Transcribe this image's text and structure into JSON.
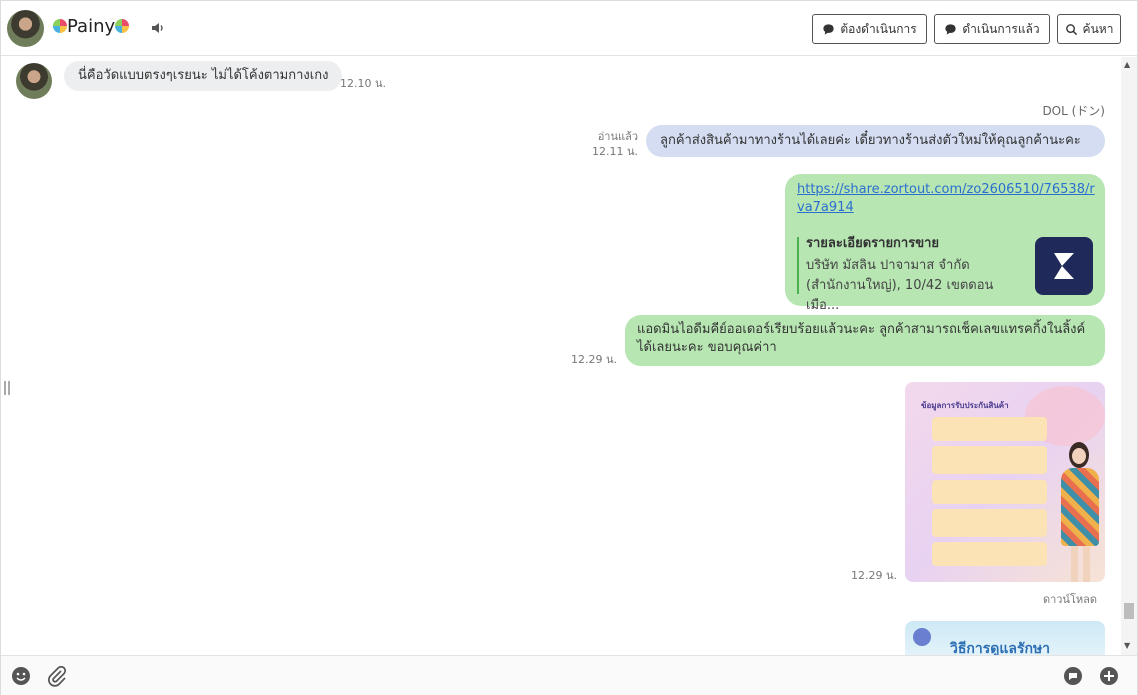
{
  "header": {
    "contact_name": "Painy",
    "buttons": {
      "todo": "ต้องดำเนินการ",
      "done": "ดำเนินการแล้ว",
      "search": "ค้นหา"
    }
  },
  "messages": {
    "m1": {
      "text": "นี่คือวัดแบบตรงๆเรยนะ ไม่ได้โค้งตามกางเกง",
      "time": "12.10 น."
    },
    "agent_name": "DOL (ドン)",
    "m2": {
      "read": "อ่านแล้ว",
      "time": "12.11 น.",
      "text": "ลูกค้าส่งสินค้ามาทางร้านได้เลยค่ะ เดี๋ยวทางร้านส่งตัวใหม่ให้คุณลูกค้านะคะ"
    },
    "m3": {
      "link_line1": "https://share.zortout.com/zo2606510/76538/r",
      "link_line2": "va7a914",
      "preview_title": "รายละเอียดรายการขาย",
      "preview_desc1": "บริษัท มัสลิน ปาจามาส จำกัด",
      "preview_desc2": "(สำนักงานใหญ่), 10/42 เขตดอนเมือ..."
    },
    "m4": {
      "time": "12.29 น.",
      "line1": "แอดมินไอดีมคีย์ออเดอร์เรียบร้อยแล้วนะคะ ลูกค้าสามารถเช็คเลขแทรคกิ้งในลิ้งค์",
      "line2": "ได้เลยนะคะ ขอบคุณค่าา"
    },
    "m5": {
      "time": "12.29 น.",
      "image_title": "ข้อมูลการรับประกันสินค้า",
      "download": "ดาวน์โหลด"
    },
    "m6": {
      "image_title": "วิธีการดูแลรักษา"
    }
  },
  "colors": {
    "incoming": "#eceef0",
    "outgoing_blue": "#d4ddf2",
    "outgoing_green": "#b7e6b3",
    "link": "#2b6fcf"
  },
  "icons": [
    "speaker-icon",
    "chat-bubble-icon",
    "search-icon",
    "emoji-icon",
    "paperclip-icon",
    "chat-reply-icon",
    "add-chat-icon",
    "zort-logo-icon"
  ]
}
